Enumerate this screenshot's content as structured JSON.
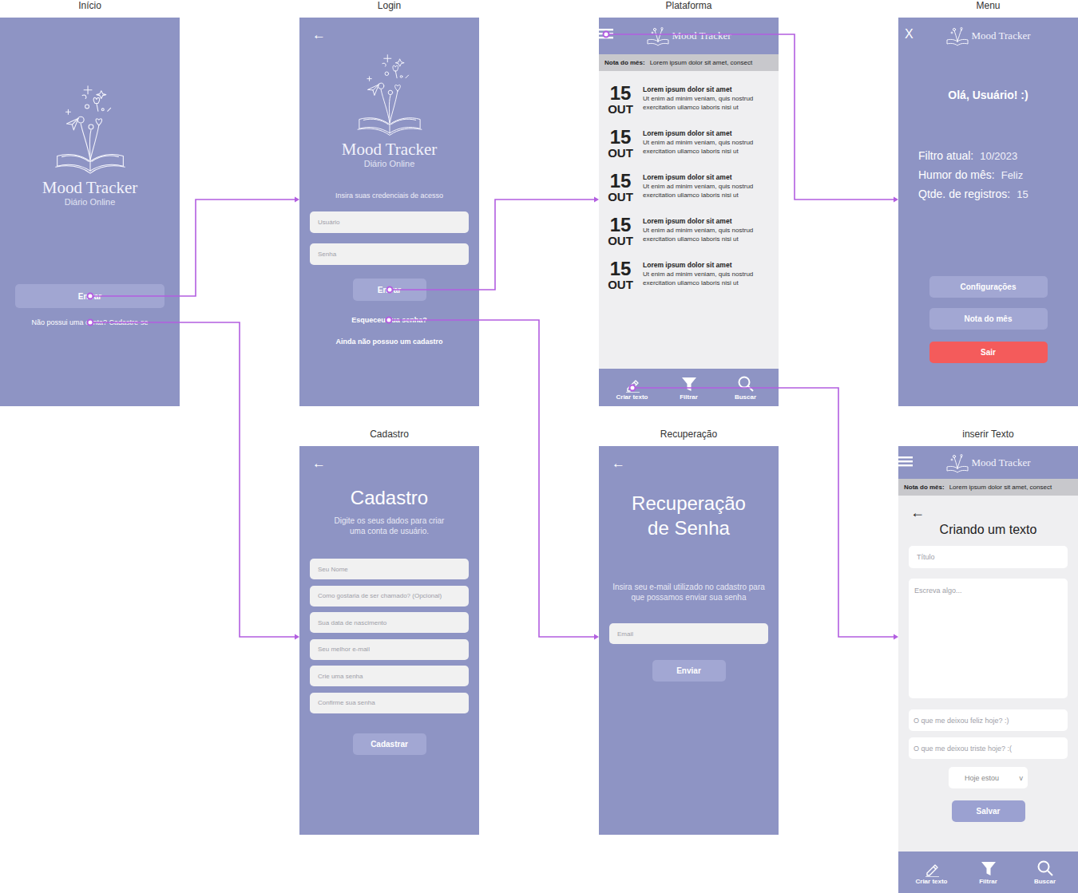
{
  "inicio": {
    "title": "Início",
    "logo": {
      "name": "Mood Tracker",
      "tagline": "Diário Online"
    },
    "enter_button": {
      "label": "Entrar",
      "goes_to": "Login"
    },
    "signup_link": {
      "label": "Não possui uma conta? Cadastre-se",
      "goes_to": "Cadastro"
    }
  },
  "login": {
    "title": "Login",
    "back": "←",
    "logo": {
      "name": "Mood Tracker",
      "tagline": "Diário Online"
    },
    "prompt": "Insira suas credenciais de acesso",
    "fields": [
      {
        "placeholder": "Usuário"
      },
      {
        "placeholder": "Senha"
      }
    ],
    "enter_button": {
      "label": "Entrar",
      "goes_to": "Plataforma"
    },
    "forgot_link": {
      "label": "Esqueceu sua senha?",
      "goes_to": "Recuperação"
    },
    "signup_link": {
      "label": "Ainda não possuo um cadastro"
    }
  },
  "plataforma": {
    "title": "Plataforma",
    "menu_button": {
      "goes_to": "Menu"
    },
    "brand": "Mood Tracker",
    "note": {
      "label": "Nota do mês:",
      "text": "Lorem ipsum dolor sit amet, consect"
    },
    "entries": [
      {
        "day": "15",
        "month": "OUT",
        "title": "Lorem ipsum dolor sit amet",
        "body": "Ut enim ad minim veniam, quis nostrud exercitation ullamco laboris nisi ut"
      },
      {
        "day": "15",
        "month": "OUT",
        "title": "Lorem ipsum dolor sit amet",
        "body": "Ut enim ad minim veniam, quis nostrud exercitation ullamco laboris nisi ut"
      },
      {
        "day": "15",
        "month": "OUT",
        "title": "Lorem ipsum dolor sit amet",
        "body": "Ut enim ad minim veniam, quis nostrud exercitation ullamco laboris nisi ut"
      },
      {
        "day": "15",
        "month": "OUT",
        "title": "Lorem ipsum dolor sit amet",
        "body": "Ut enim ad minim veniam, quis nostrud exercitation ullamco laboris nisi ut"
      },
      {
        "day": "15",
        "month": "OUT",
        "title": "Lorem ipsum dolor sit amet",
        "body": "Ut enim ad minim veniam, quis nostrud exercitation ullamco laboris nisi ut"
      }
    ],
    "nav": [
      {
        "label": "Criar texto",
        "kind": "pencil",
        "goes_to": "inserir Texto"
      },
      {
        "label": "Filtrar",
        "kind": "filter"
      },
      {
        "label": "Buscar",
        "kind": "search"
      }
    ]
  },
  "menu": {
    "title": "Menu",
    "close": "X",
    "brand": "Mood Tracker",
    "greeting": "Olá, Usuário! :)",
    "stats": [
      {
        "label": "Filtro atual:",
        "value": "10/2023"
      },
      {
        "label": "Humor do mês:",
        "value": "Feliz"
      },
      {
        "label": "Qtde. de registros:",
        "value": "15"
      }
    ],
    "buttons": [
      {
        "label": "Configurações",
        "kind": "normal"
      },
      {
        "label": "Nota do mês",
        "kind": "normal"
      },
      {
        "label": "Sair",
        "kind": "danger"
      }
    ]
  },
  "cadastro": {
    "title": "Cadastro",
    "back": "←",
    "heading": "Cadastro",
    "subtitle": "Digite os seus dados para criar uma conta de usuário.",
    "fields": [
      "Seu Nome",
      "Como gostaria de ser chamado? (Opcional)",
      "Sua data de nascimento",
      "Seu melhor e-mail",
      "Crie uma senha",
      "Confirme sua senha"
    ],
    "submit": "Cadastrar"
  },
  "recuperacao": {
    "title": "Recuperação",
    "back": "←",
    "heading": "Recuperação de Senha",
    "subtitle": "Insira seu e-mail utilizado no cadastro para que possamos enviar sua senha",
    "field": "Email",
    "submit": "Enviar"
  },
  "inserir": {
    "title": "inserir Texto",
    "brand": "Mood Tracker",
    "note": {
      "label": "Nota do mês:",
      "text": "Lorem ipsum dolor sit amet, consect"
    },
    "back": "←",
    "heading": "Criando um texto",
    "title_field": "Título",
    "body_field": "Escreva algo...",
    "mood_fields": [
      "O que me deixou feliz hoje? :)",
      "O que me deixou triste hoje? :("
    ],
    "mood_select": {
      "label": "Hoje estou",
      "arrow": "v"
    },
    "save": "Salvar",
    "nav": [
      {
        "label": "Criar texto",
        "kind": "pencil"
      },
      {
        "label": "Filtrar",
        "kind": "filter"
      },
      {
        "label": "Buscar",
        "kind": "search"
      }
    ]
  }
}
